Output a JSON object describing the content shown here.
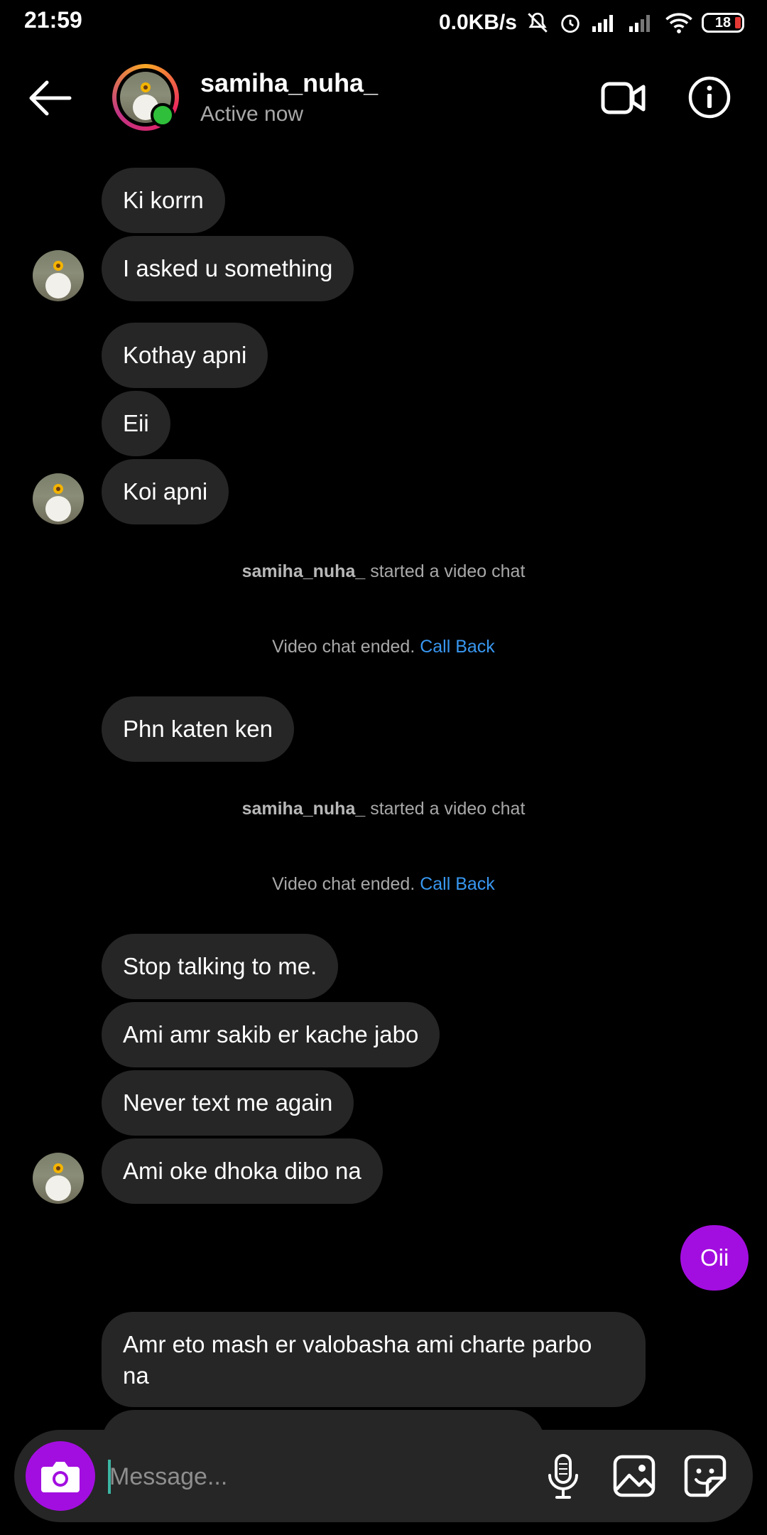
{
  "status_bar": {
    "time": "21:59",
    "net_speed": "0.0KB/s",
    "battery": "18",
    "icons": [
      "mute-icon",
      "alarm-icon",
      "signal-icon",
      "signal-icon",
      "wifi-icon",
      "battery-icon"
    ]
  },
  "header": {
    "username": "samiha_nuha_",
    "status": "Active now"
  },
  "messages": [
    {
      "text": "Ki korrn"
    },
    {
      "text": "I asked u something"
    },
    {
      "text": "Kothay apni"
    },
    {
      "text": "Eii"
    },
    {
      "text": "Koi apni"
    },
    {
      "text": "Phn katen ken"
    },
    {
      "text": "Stop talking to me."
    },
    {
      "text": "Ami amr sakib er kache jabo"
    },
    {
      "text": "Never text me again"
    },
    {
      "text": "Ami oke dhoka dibo na"
    },
    {
      "text": "Oii"
    },
    {
      "text": "Amr eto mash er valobasha ami charte parbo na"
    }
  ],
  "system": {
    "started_user": "samiha_nuha_",
    "started_text": " started a video chat",
    "ended_text": "Video chat ended. ",
    "call_back": "Call Back"
  },
  "composer": {
    "placeholder": "Message..."
  },
  "colors": {
    "background": "#000000",
    "bubble_theirs": "#262626",
    "bubble_mine": "#a30ee0",
    "link": "#3897f0",
    "online": "#2fbf3a"
  }
}
